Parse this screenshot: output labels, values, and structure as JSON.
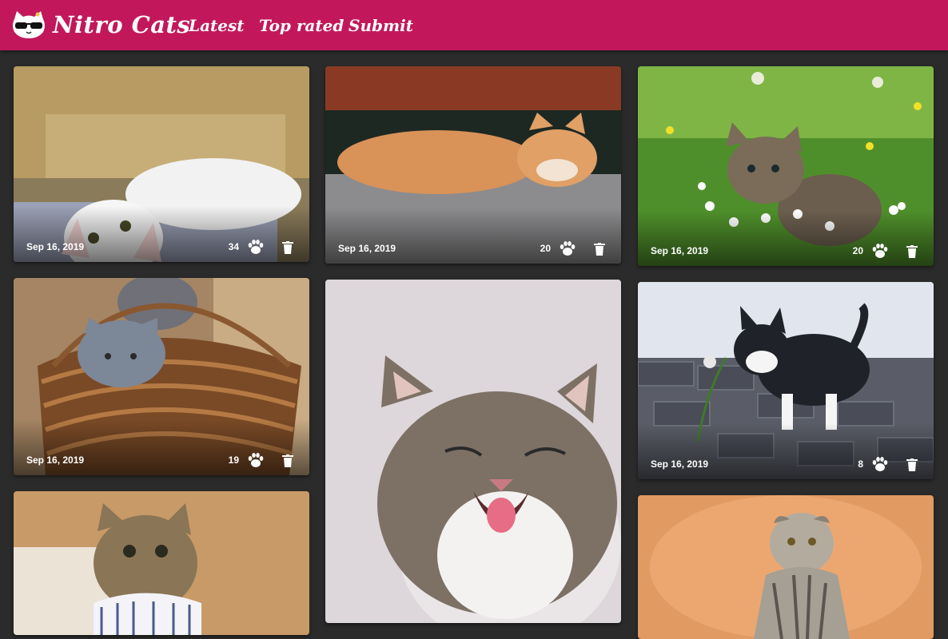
{
  "app": {
    "title": "Nitro Cats",
    "brand_color": "#c2185b",
    "background": "#2b2b2b"
  },
  "nav": {
    "items": [
      {
        "label": "Latest"
      },
      {
        "label": "Top rated"
      },
      {
        "label": "Submit"
      }
    ]
  },
  "cards": [
    {
      "date": "Sep 16, 2019",
      "likes": "34",
      "like_icon": "paw-icon",
      "delete_icon": "trash-icon",
      "photo": "white kitten lying on blanket"
    },
    {
      "date": "Sep 16, 2019",
      "likes": "20",
      "like_icon": "paw-icon",
      "delete_icon": "trash-icon",
      "photo": "orange kitten sleeping on floor"
    },
    {
      "date": "Sep 16, 2019",
      "likes": "20",
      "like_icon": "paw-icon",
      "delete_icon": "trash-icon",
      "photo": "tabby kitten in flower meadow"
    },
    {
      "date": "Sep 16, 2019",
      "likes": "19",
      "like_icon": "paw-icon",
      "delete_icon": "trash-icon",
      "photo": "grey kitten in wicker basket"
    },
    {
      "date": "",
      "likes": "",
      "photo": "yawning tabby kitten"
    },
    {
      "date": "Sep 16, 2019",
      "likes": "8",
      "like_icon": "paw-icon",
      "delete_icon": "trash-icon",
      "photo": "kitten pawing at plant on cobblestones"
    },
    {
      "date": "",
      "likes": "",
      "photo": "tabby cat in knitted basket"
    },
    {
      "date": "",
      "likes": "",
      "photo": "scottish fold cat on orange background"
    }
  ]
}
